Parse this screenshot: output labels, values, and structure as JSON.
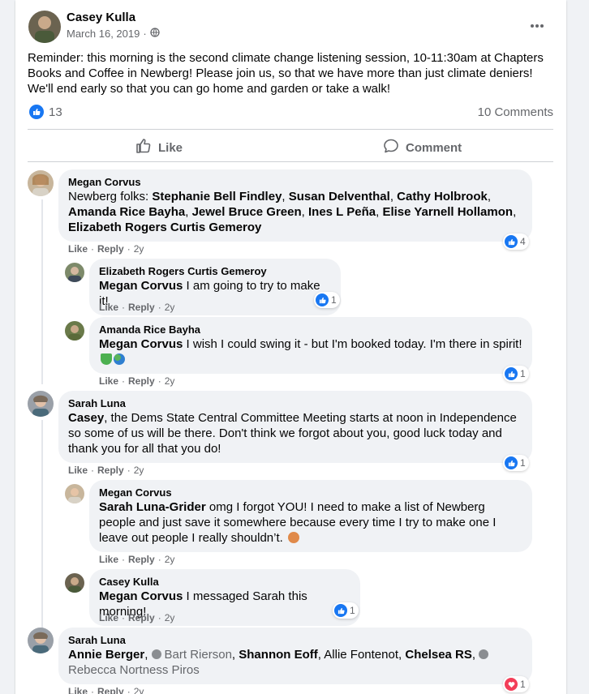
{
  "post": {
    "author": "Casey Kulla",
    "date": "March 16, 2019",
    "text": "Reminder: this morning is the second climate change listening session, 10-11:30am at Chapters Books and Coffee in Newberg! Please join us, so that we have more than just climate deniers! We'll end early so that you can go home and garden or take a walk!",
    "reaction_count": "13",
    "comments_count": "10 Comments",
    "like_label": "Like",
    "comment_label": "Comment"
  },
  "comment_actions": {
    "like": "Like",
    "reply": "Reply",
    "sep": "·"
  },
  "comments": [
    {
      "name": "Megan Corvus",
      "segments": [
        "Newberg folks: ",
        "Stephanie Bell Findley",
        ", ",
        "Susan Delventhal",
        ", ",
        "Cathy Holbrook",
        ", ",
        "Amanda Rice Bayha",
        ", ",
        "Jewel Bruce Green",
        ", ",
        "Ines L Peña",
        ", ",
        "Elise Yarnell Hollamon",
        ", ",
        "Elizabeth Rogers Curtis Gemeroy"
      ],
      "age": "2y",
      "reactions": "4"
    },
    {
      "name": "Elizabeth Rogers Curtis Gemeroy",
      "tag": "Megan Corvus",
      "text": " I am going to try to make it!",
      "age": "2y",
      "reactions": "1"
    },
    {
      "name": "Amanda Rice Bayha",
      "tag": "Megan Corvus",
      "text": " I wish I could swing it - but I'm booked today. I'm there in spirit!",
      "age": "2y",
      "reactions": "1"
    },
    {
      "name": "Sarah Luna",
      "tag": "Casey",
      "text": ", the Dems State Central Committee Meeting starts at noon in Independence so some of us will be there. Don't think we forgot about you, good luck today and thank you for all that you do!",
      "age": "2y",
      "reactions": "1"
    },
    {
      "name": "Megan Corvus",
      "tag": "Sarah Luna-Grider",
      "text": " omg I forgot YOU! I need to make a list of Newberg people and just save it somewhere because every time I try to make one I leave out people I really shouldn’t.",
      "age": "2y"
    },
    {
      "name": "Casey Kulla",
      "tag": "Megan Corvus",
      "text": " I messaged Sarah this morning!",
      "age": "2y",
      "reactions": "1"
    },
    {
      "name": "Sarah Luna",
      "segments": [
        "Annie Berger",
        ", ",
        "Bart Rierson",
        ", ",
        "Shannon Eoff",
        ", ",
        "Allie Fontenot",
        ", ",
        "Chelsea RS",
        ", ",
        "Rebecca Nortness Piros"
      ],
      "age": "2y",
      "reactions": "1"
    }
  ],
  "colors": {
    "like_blue": "#1877f2",
    "heart_red": "#f33e58",
    "bubble": "#f0f2f5",
    "muted": "#65676b"
  },
  "icons": [
    "globe-icon",
    "more-options-icon",
    "thumbs-up-icon",
    "comment-icon",
    "heart-icon",
    "earth-emoji-icon",
    "green-heart-emoji-icon"
  ]
}
